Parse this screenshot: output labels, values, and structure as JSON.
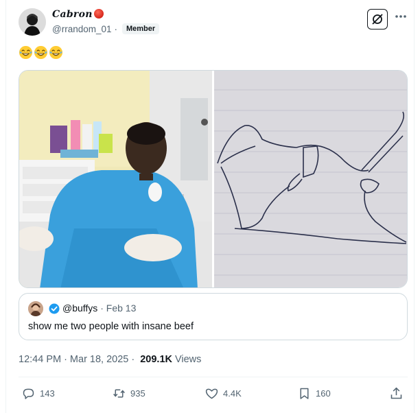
{
  "author": {
    "display_name": "Cabron",
    "name_emoji": "red-ball-emoji",
    "handle": "@rrandom_01",
    "separator": "·",
    "badge": "Member"
  },
  "header_buttons": {
    "grok_icon": "grok-icon",
    "more_icon": "more-icon"
  },
  "post": {
    "emojis": [
      "face-with-tears-of-joy",
      "face-with-tears-of-joy",
      "face-with-tears-of-joy"
    ],
    "media": [
      {
        "icon": "hospital-photo"
      },
      {
        "icon": "pen-sketch-drawing"
      }
    ]
  },
  "quote": {
    "handle": "@buffys",
    "separator": "·",
    "date": "Feb 13",
    "text": "show me two people with insane beef"
  },
  "meta": {
    "time": "12:44 PM",
    "separator": "·",
    "date": "Mar 18, 2025",
    "views_count": "209.1K",
    "views_label": "Views"
  },
  "actions": {
    "replies": "143",
    "reposts": "935",
    "likes": "4.4K",
    "bookmarks": "160"
  },
  "colors": {
    "text": "#0f1419",
    "secondary": "#536471",
    "border": "#cfd9de",
    "verified": "#1d9bf0"
  }
}
